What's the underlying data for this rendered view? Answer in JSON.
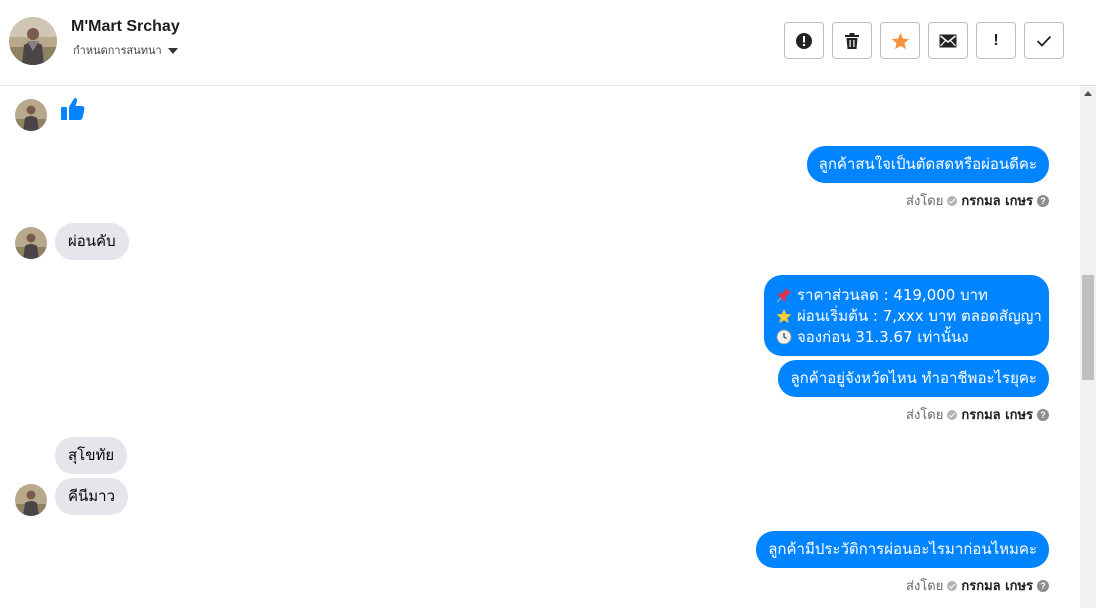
{
  "header": {
    "contact_name": "M'Mart Srchay",
    "assign_label": "กำหนดการสนทนา",
    "actions": [
      {
        "name": "report-spam",
        "icon": "alert-circle-icon"
      },
      {
        "name": "delete",
        "icon": "trash-icon"
      },
      {
        "name": "star",
        "icon": "star-icon",
        "color": "#f7923a"
      },
      {
        "name": "mark-unread",
        "icon": "envelope-icon"
      },
      {
        "name": "mark-important",
        "icon": "exclamation-icon",
        "label": "!"
      },
      {
        "name": "mark-done",
        "icon": "checkmark-icon"
      }
    ]
  },
  "messages": {
    "incoming_like": {
      "icon": "thumbs-up-icon",
      "color": "#0084ff"
    },
    "out_1": "ลูกค้าสนใจเป็นตัดสดหรือผ่อนดีคะ",
    "in_1": "ผ่อนคับ",
    "out_2_lines": [
      {
        "icon": "pushpin-icon",
        "text": "ราคาส่วนลด : 419,000 บาท"
      },
      {
        "icon": "star-icon",
        "text": "ผ่อนเริ่มต้น : 7,xxx บาท ตลอดสัญญา"
      },
      {
        "icon": "clock-icon",
        "text": "จองก่อน 31.3.67 เท่านั้นง"
      }
    ],
    "out_3": "ลูกค้าอยู่จังหวัดไหน ทำอาชีพอะไรยุคะ",
    "in_2": "สุโขทัย",
    "in_3": "คีนีมาว",
    "out_4": "ลูกค้ามีประวัติการผ่อนอะไรมาก่อนไหมคะ"
  },
  "sent_by": {
    "prefix": "ส่งโดย",
    "agent": "กรกมล เกษร",
    "help": "?"
  },
  "colors": {
    "outgoing_bubble": "#0084ff",
    "incoming_bubble": "#e4e6eb"
  }
}
